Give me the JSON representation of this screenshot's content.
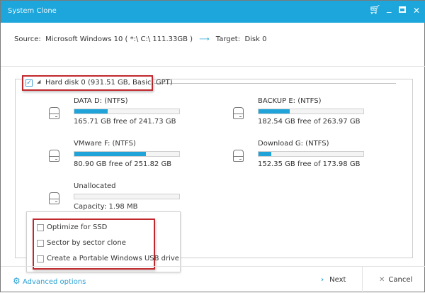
{
  "window": {
    "title": "System Clone"
  },
  "source_line": {
    "source_label": "Source:",
    "source_value": "Microsoft Windows 10 ( *:\\ C:\\  111.33GB )",
    "arrow": "⟶",
    "target_label": "Target:",
    "target_value": "Disk 0"
  },
  "disk": {
    "label": "Hard disk 0 (931.51 GB, Basic, GPT)",
    "checked": true
  },
  "partitions": [
    {
      "name": "DATA D: (NTFS)",
      "free": "165.71 GB free of 241.73 GB",
      "used_pct": 32
    },
    {
      "name": "BACKUP E: (NTFS)",
      "free": "182.54 GB free of 263.97 GB",
      "used_pct": 30
    },
    {
      "name": "VMware F: (NTFS)",
      "free": "80.90 GB free of 251.82 GB",
      "used_pct": 68
    },
    {
      "name": "Download G: (NTFS)",
      "free": "152.35 GB free of 173.98 GB",
      "used_pct": 12
    },
    {
      "name": "Unallocated",
      "free": "Capacity: 1.98 MB",
      "used_pct": 0
    }
  ],
  "advanced_popup": {
    "options": [
      {
        "label": "Optimize for SSD",
        "checked": false
      },
      {
        "label": "Sector by sector clone",
        "checked": false
      },
      {
        "label": "Create a Portable Windows USB drive",
        "checked": false
      }
    ]
  },
  "footer": {
    "advanced_label": "Advanced options",
    "next_label": "Next",
    "cancel_label": "Cancel"
  },
  "colors": {
    "accent": "#1ca6db",
    "highlight": "#c0282d"
  }
}
